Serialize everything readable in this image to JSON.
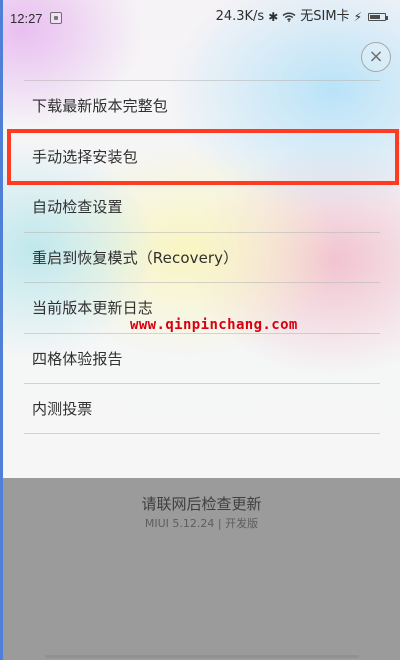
{
  "status_bar": {
    "time": "12:27",
    "network_speed": "24.3K/s",
    "sim_status": "无SIM卡",
    "icons": {
      "notification": "notification-icon",
      "bluetooth": "bluetooth-icon",
      "wifi": "wifi-icon",
      "charging": "charging-icon",
      "battery": "battery-icon"
    }
  },
  "sheet": {
    "close_icon": "close-icon",
    "menu_items": [
      {
        "label": "下载最新版本完整包"
      },
      {
        "label": "手动选择安装包"
      },
      {
        "label": "自动检查设置"
      },
      {
        "label": "重启到恢复模式（Recovery）"
      },
      {
        "label": "当前版本更新日志"
      },
      {
        "label": "四格体验报告"
      },
      {
        "label": "内测投票"
      }
    ],
    "highlighted_item_index": 1
  },
  "watermark": {
    "text": "www.qinpinchang.com",
    "color": "#d9000d"
  },
  "bottom": {
    "title": "请联网后检查更新",
    "version": "MIUI 5.12.24 | 开发版"
  },
  "colors": {
    "highlight": "#ff3b22",
    "overlay": "#9b9b9b"
  }
}
